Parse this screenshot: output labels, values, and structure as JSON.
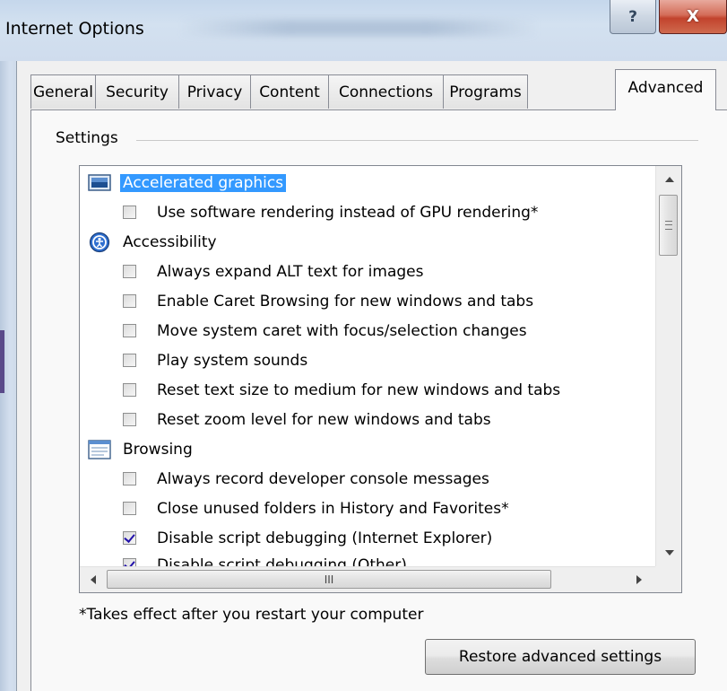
{
  "window": {
    "title": "Internet Options",
    "help_glyph": "?",
    "close_glyph": "X"
  },
  "tabs": [
    {
      "label": "General"
    },
    {
      "label": "Security"
    },
    {
      "label": "Privacy"
    },
    {
      "label": "Content"
    },
    {
      "label": "Connections"
    },
    {
      "label": "Programs"
    },
    {
      "label": "Advanced",
      "active": true
    }
  ],
  "settings": {
    "group_label": "Settings",
    "items": [
      {
        "kind": "category",
        "icon": "monitor-icon",
        "label": "Accelerated graphics",
        "selected": true
      },
      {
        "kind": "option",
        "label": "Use software rendering instead of GPU rendering*",
        "checked": false
      },
      {
        "kind": "category",
        "icon": "accessibility-icon",
        "label": "Accessibility"
      },
      {
        "kind": "option",
        "label": "Always expand ALT text for images",
        "checked": false
      },
      {
        "kind": "option",
        "label": "Enable Caret Browsing for new windows and tabs",
        "checked": false
      },
      {
        "kind": "option",
        "label": "Move system caret with focus/selection changes",
        "checked": false
      },
      {
        "kind": "option",
        "label": "Play system sounds",
        "checked": false
      },
      {
        "kind": "option",
        "label": "Reset text size to medium for new windows and tabs",
        "checked": false
      },
      {
        "kind": "option",
        "label": "Reset zoom level for new windows and tabs",
        "checked": false
      },
      {
        "kind": "category",
        "icon": "browser-window-icon",
        "label": "Browsing"
      },
      {
        "kind": "option",
        "label": "Always record developer console messages",
        "checked": false
      },
      {
        "kind": "option",
        "label": "Close unused folders in History and Favorites*",
        "checked": false
      },
      {
        "kind": "option",
        "label": "Disable script debugging (Internet Explorer)",
        "checked": true
      },
      {
        "kind": "option",
        "label": "Disable script debugging (Other)",
        "checked": true
      }
    ]
  },
  "hscroll_thumb_glyph": "III",
  "note": "*Takes effect after you restart your computer",
  "restore_button": "Restore advanced settings",
  "colors": {
    "selection": "#3399ff",
    "close_button": "#c2432d",
    "titlebar": "#c5d7ec"
  }
}
